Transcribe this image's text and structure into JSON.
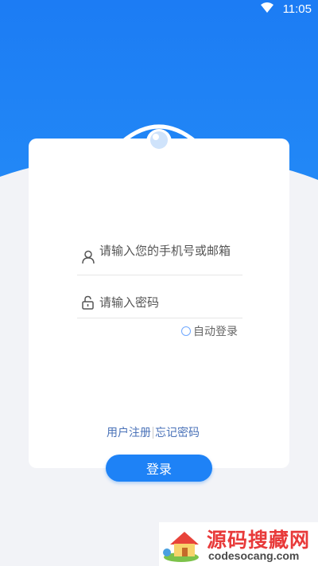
{
  "status_bar": {
    "time": "11:05"
  },
  "login": {
    "username_placeholder": "请输入您的手机号或邮箱",
    "password_placeholder": "请输入密码",
    "auto_login_label": "自动登录",
    "register_link": "用户注册",
    "forgot_password_link": "忘记密码",
    "login_button": "登录"
  },
  "watermark": {
    "title": "源码搜藏网",
    "domain": "codesocang.com"
  },
  "colors": {
    "primary": "#1e82f6",
    "background": "#f2f3f7",
    "card": "#ffffff",
    "link": "#4a72b8"
  }
}
